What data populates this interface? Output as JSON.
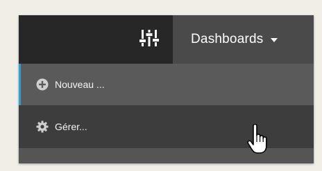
{
  "toolbar": {
    "settings_icon": "sliders-icon",
    "dashboards_label": "Dashboards",
    "dropdown_icon": "caret-down-icon"
  },
  "menu": {
    "items": [
      {
        "label": "Nouveau ...",
        "icon": "plus-circle-icon"
      },
      {
        "label": "Gérer...",
        "icon": "gear-icon"
      }
    ]
  },
  "colors": {
    "toolbar_dark": "#272727",
    "dashboards_bg": "#4a4a4a",
    "item_bg": "#5a5a5a",
    "item_hover_bg": "#3d3d3d",
    "accent": "#2aa1d4",
    "page_bg": "#f1eee6"
  },
  "cursor": "hand-pointer-icon"
}
